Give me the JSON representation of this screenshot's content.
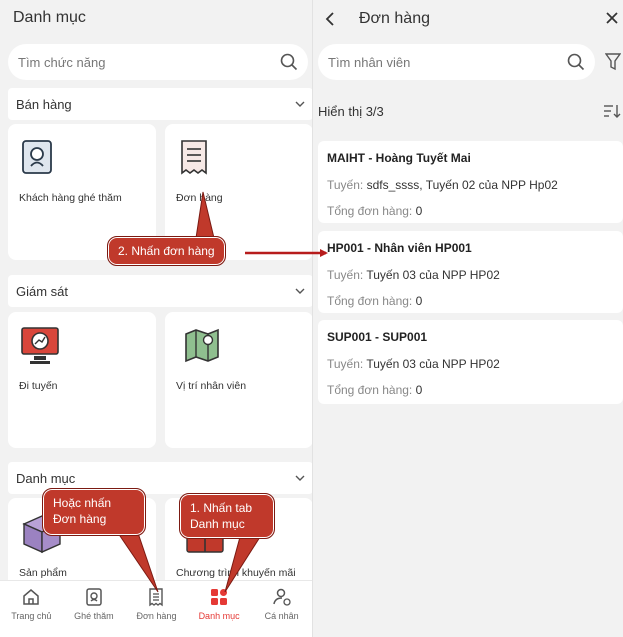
{
  "left": {
    "title": "Danh mục",
    "search_placeholder": "Tìm chức năng",
    "sections": [
      {
        "title": "Bán hàng",
        "items": [
          "Khách hàng ghé thăm",
          "Đơn hàng"
        ]
      },
      {
        "title": "Giám sát",
        "items": [
          "Đi tuyến",
          "Vị trí nhân viên"
        ]
      },
      {
        "title": "Danh mục",
        "items": [
          "Sản phẩm",
          "Chương trình khuyến mãi"
        ]
      }
    ],
    "nav": [
      {
        "label": "Trang chủ",
        "icon": "home-icon"
      },
      {
        "label": "Ghé thăm",
        "icon": "visit-icon"
      },
      {
        "label": "Đơn hàng",
        "icon": "order-icon"
      },
      {
        "label": "Danh mục",
        "icon": "grid-icon",
        "active": true
      },
      {
        "label": "Cá nhân",
        "icon": "person-icon"
      }
    ]
  },
  "right": {
    "title": "Đơn hàng",
    "search_placeholder": "Tìm nhân viên",
    "count_text": "Hiển thị 3/3",
    "route_label": "Tuyến:",
    "total_label": "Tổng đơn hàng:",
    "cards": [
      {
        "name": "MAIHT - Hoàng Tuyết Mai",
        "route": "sdfs_ssss, Tuyến 02 của NPP Hp02",
        "total": "0"
      },
      {
        "name": "HP001 - Nhân viên HP001",
        "route": "Tuyến 03 của NPP HP02",
        "total": "0"
      },
      {
        "name": "SUP001 - SUP001",
        "route": "Tuyến 03 của NPP HP02",
        "total": "0"
      }
    ]
  },
  "callouts": {
    "step2": "2. Nhấn đơn hàng",
    "alt": [
      "Hoặc nhấn",
      "Đơn hàng"
    ],
    "step1": [
      "1. Nhấn tab",
      "Danh mục"
    ]
  },
  "colors": {
    "accent": "#e53935",
    "callout": "#c0392b"
  }
}
